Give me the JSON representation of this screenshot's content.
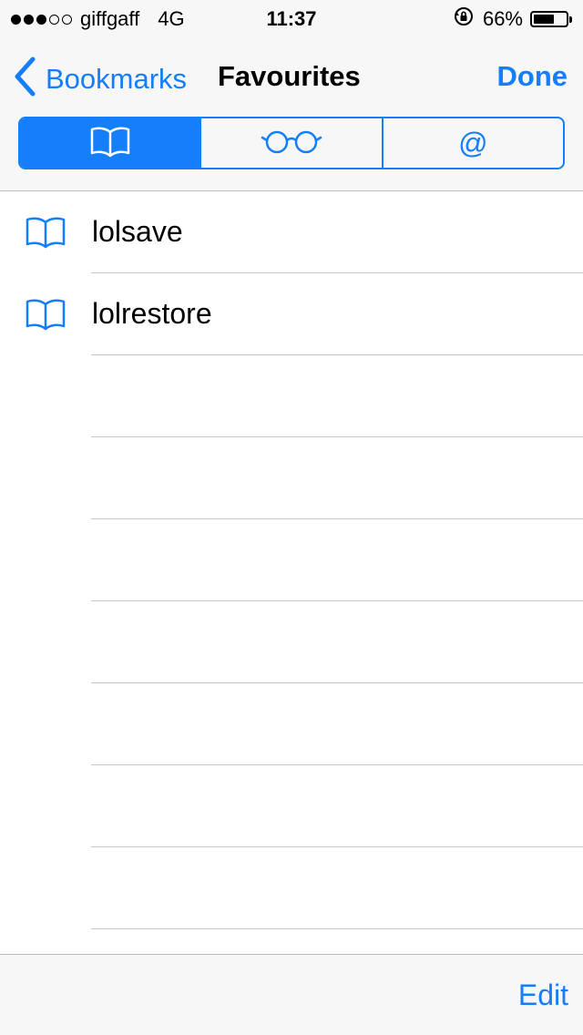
{
  "status_bar": {
    "signal_bars_filled": 3,
    "signal_bars_total": 5,
    "carrier": "giffgaff",
    "network": "4G",
    "time": "11:37",
    "rotation_lock_icon": "rotation-lock-icon",
    "battery_percent": "66%",
    "battery_level": 0.66
  },
  "nav": {
    "back_label": "Bookmarks",
    "title": "Favourites",
    "done_label": "Done"
  },
  "segments": [
    {
      "name": "bookmarks",
      "icon": "open-book-icon",
      "active": true
    },
    {
      "name": "reading-list",
      "icon": "glasses-icon",
      "active": false
    },
    {
      "name": "shared-links",
      "icon": "at-sign-icon",
      "symbol": "@",
      "active": false
    }
  ],
  "bookmarks": [
    {
      "label": "lolsave"
    },
    {
      "label": "lolrestore"
    }
  ],
  "toolbar": {
    "edit_label": "Edit"
  },
  "colors": {
    "accent": "#157efb",
    "bar_background": "#f7f7f7",
    "separator": "#c8c7cc"
  }
}
